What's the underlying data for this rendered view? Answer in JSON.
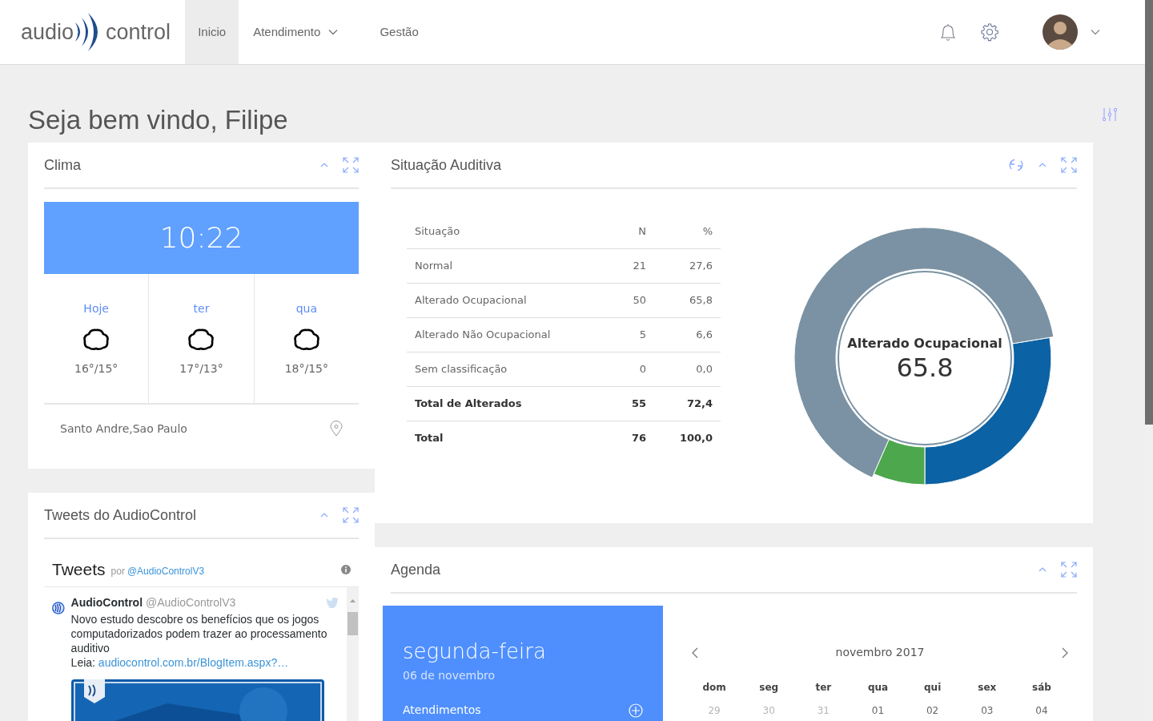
{
  "navbar": {
    "logo": {
      "left": "audio",
      "right": "control"
    },
    "items": [
      {
        "label": "Inicio",
        "selected": true,
        "dropdown": false
      },
      {
        "label": "Atendimento",
        "selected": false,
        "dropdown": true
      },
      {
        "label": "Gestão",
        "selected": false,
        "dropdown": false
      }
    ]
  },
  "greeting": "Seja bem vindo, Filipe",
  "clima": {
    "title": "Clima",
    "time": "10:22",
    "forecast": [
      {
        "day": "Hoje",
        "temps": "16°/15°"
      },
      {
        "day": "ter",
        "temps": "17°/13°"
      },
      {
        "day": "qua",
        "temps": "18°/15°"
      }
    ],
    "location": "Santo Andre,Sao Paulo"
  },
  "tweets": {
    "title": "Tweets do AudioControl",
    "heading": "Tweets",
    "by": "por",
    "account": "@AudioControlV3",
    "items": [
      {
        "name": "AudioControl",
        "handle": "@AudioControlV3",
        "text": "Novo estudo descobre os benefícios que os jogos computadorizados podem trazer ao processamento auditivo",
        "lead": "Leia:",
        "link": "audiocontrol.com.br/BlogItem.aspx?…"
      }
    ]
  },
  "situacao": {
    "title": "Situação Auditiva",
    "table": {
      "columns": [
        "Situação",
        "N",
        "%"
      ],
      "rows": [
        {
          "cells": [
            "Normal",
            "21",
            "27,6"
          ],
          "bold": false
        },
        {
          "cells": [
            "Alterado Ocupacional",
            "50",
            "65,8"
          ],
          "bold": false
        },
        {
          "cells": [
            "Alterado Não Ocupacional",
            "5",
            "6,6"
          ],
          "bold": false
        },
        {
          "cells": [
            "Sem classificação",
            "0",
            "0,0"
          ],
          "bold": false
        },
        {
          "cells": [
            "Total de Alterados",
            "55",
            "72,4"
          ],
          "bold": true
        },
        {
          "cells": [
            "Total",
            "76",
            "100,0"
          ],
          "bold": true
        }
      ]
    },
    "donut": {
      "highlight": {
        "label": "Alterado Ocupacional",
        "value": "65.8"
      },
      "slices": [
        {
          "color": "#0b62a4",
          "selected": false
        },
        {
          "color": "#7a92a3",
          "selected": true
        },
        {
          "color": "#4da74d",
          "selected": false
        }
      ],
      "chart_data": {
        "type": "donut",
        "values": [
          27.6,
          65.8,
          6.6
        ]
      }
    }
  },
  "agenda": {
    "title": "Agenda",
    "day": "segunda-feira",
    "date": "06 de novembro",
    "section": "Atendimentos",
    "calendar": {
      "month": "novembro 2017",
      "weekdays": [
        "dom",
        "seg",
        "ter",
        "qua",
        "qui",
        "sex",
        "sáb"
      ],
      "days": [
        {
          "label": "29",
          "outside": true
        },
        {
          "label": "30",
          "outside": true
        },
        {
          "label": "31",
          "outside": true
        },
        {
          "label": "01",
          "outside": false
        },
        {
          "label": "02",
          "outside": false
        },
        {
          "label": "03",
          "outside": false
        },
        {
          "label": "04",
          "outside": false
        }
      ]
    }
  }
}
